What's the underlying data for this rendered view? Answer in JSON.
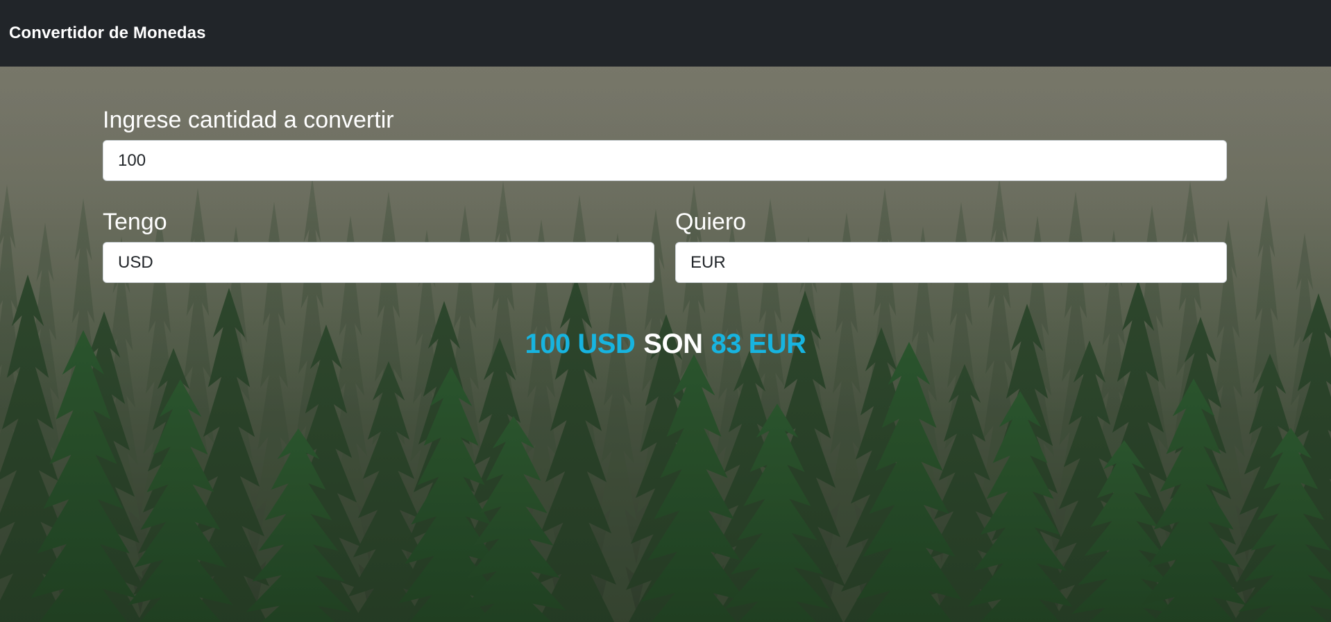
{
  "navbar": {
    "brand": "Convertidor de Monedas"
  },
  "form": {
    "amount": {
      "label": "Ingrese cantidad a convertir",
      "value": "100"
    },
    "from": {
      "label": "Tengo",
      "value": "USD"
    },
    "to": {
      "label": "Quiero",
      "value": "EUR"
    }
  },
  "result": {
    "from_text": "100 USD",
    "connector": "SON",
    "to_text": "83 EUR"
  },
  "colors": {
    "navbar_bg": "#212529",
    "highlight": "#17b4e0",
    "text_light": "#ffffff"
  }
}
